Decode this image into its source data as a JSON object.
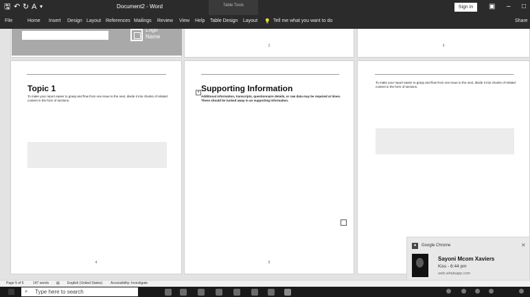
{
  "titlebar": {
    "document_title": "Document2 - Word",
    "context_group": "Table Tools",
    "sign_in": "Sign in",
    "quick_access": [
      "save-icon",
      "undo-icon",
      "redo-icon",
      "customize-icon"
    ]
  },
  "ribbon": {
    "tabs": [
      "File",
      "Home",
      "Insert",
      "Design",
      "Layout",
      "References",
      "Mailings",
      "Review",
      "View",
      "Help",
      "Table Design",
      "Layout"
    ],
    "tell_me": "Tell me what you want to do",
    "share": "Share"
  },
  "logo": {
    "text": "Logo\nName"
  },
  "pages": {
    "p2": {
      "number": "2"
    },
    "p3": {
      "number": "3"
    },
    "p4": {
      "heading": "Topic 1",
      "body": "To make your report easier to grasp and flow from one issue to the next, divide it into chunks of related content in the form of sections.",
      "number": "4"
    },
    "p5": {
      "heading": "Supporting Information",
      "body": "Additional information, transcripts, questionnaire details, or raw data may be required at times. These should be tucked away in an supporting information.",
      "number": "5"
    },
    "p6": {
      "body": "To make your report easier to grasp and flow from one issue to the next, divide it into chunks of related content in the form of sections."
    }
  },
  "notification": {
    "app": "Google Chrome",
    "sender": "Sayoni Mcom Xaviers",
    "message": "Kiss - 6:44 pm",
    "site": "web.whatsapp.com"
  },
  "statusbar": {
    "page": "Page 5 of 6",
    "words": "147 words",
    "language": "English (United States)",
    "accessibility": "Accessibility: Investigate"
  },
  "taskbar": {
    "search_placeholder": "Type here to search"
  }
}
